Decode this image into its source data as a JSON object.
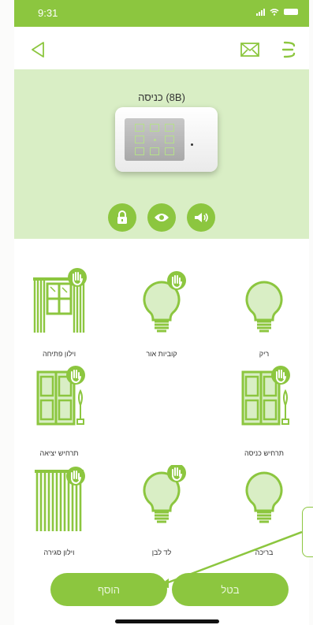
{
  "status_bar": {
    "time": "9:31"
  },
  "nav": {
    "back_icon": "back-triangle-icon",
    "mail_icon": "mail-icon",
    "menu_icon": "menu-icon"
  },
  "device": {
    "title": "כניסה (8B)",
    "mode_icons": [
      "lock-icon",
      "eye-icon",
      "sound-icon"
    ]
  },
  "scenes": [
    {
      "label": "ריק",
      "icon": "bulb-icon",
      "hand": false
    },
    {
      "label": "קוביות אור",
      "icon": "bulb-icon",
      "hand": true
    },
    {
      "label": "וילון פתיחה",
      "icon": "curtain-open-icon",
      "hand": true
    },
    {
      "label": "תרחיש כניסה",
      "icon": "door-icon",
      "hand": true
    },
    {
      "label": "",
      "icon": "none",
      "hand": false
    },
    {
      "label": "תרחיש יציאה",
      "icon": "door-icon",
      "hand": true
    },
    {
      "label": "בריכה",
      "icon": "bulb-icon",
      "hand": false
    },
    {
      "label": "לד לבן",
      "icon": "bulb-icon",
      "hand": true
    },
    {
      "label": "וילון סגירה",
      "icon": "curtain-closed-icon",
      "hand": true
    }
  ],
  "buttons": {
    "add_label": "הוסף",
    "cancel_label": "בטל"
  },
  "colors": {
    "accent": "#8cc63f",
    "panel": "#d9eec5"
  }
}
